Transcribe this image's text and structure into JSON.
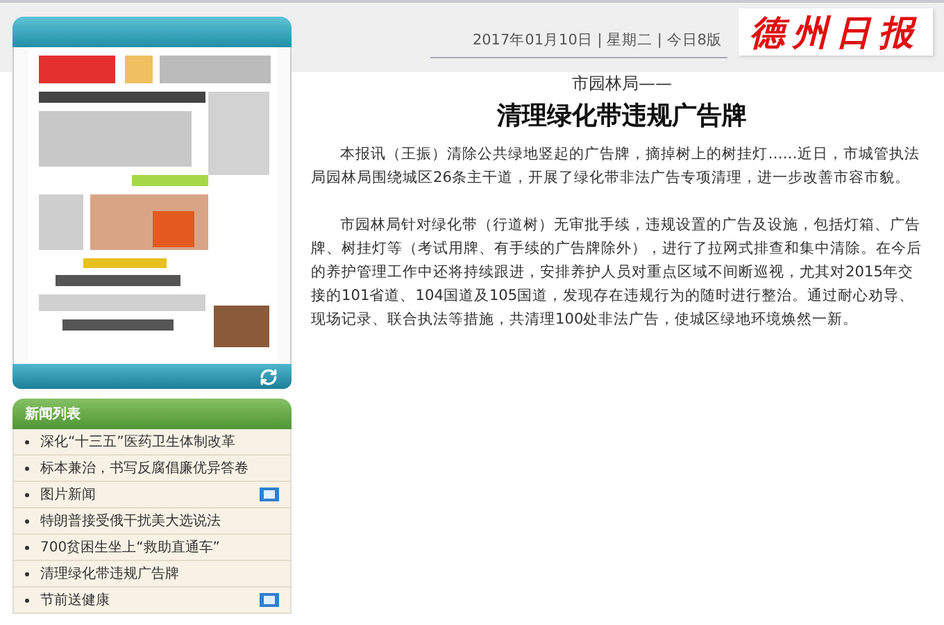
{
  "header": {
    "date_line": "2017年01月10日 | 星期二 | 今日8版",
    "logo": "德州日报"
  },
  "news_list": {
    "title": "新闻列表",
    "items": [
      {
        "text": "深化“十三五”医药卫生体制改革",
        "video": false
      },
      {
        "text": "标本兼治，书写反腐倡廉优异答卷",
        "video": false
      },
      {
        "text": "图片新闻",
        "video": true
      },
      {
        "text": "特朗普接受俄干扰美大选说法",
        "video": false
      },
      {
        "text": "700贫困生坐上“救助直通车”",
        "video": false
      },
      {
        "text": "清理绿化带违规广告牌",
        "video": false
      },
      {
        "text": "节前送健康",
        "video": true
      }
    ]
  },
  "article": {
    "kicker": "市园林局——",
    "title": "清理绿化带违规广告牌",
    "paragraphs": [
      "本报讯（王振）清除公共绿地竖起的广告牌，摘掉树上的树挂灯……近日，市城管执法局园林局围绕城区26条主干道，开展了绿化带非法广告专项清理，进一步改善市容市貌。",
      "市园林局针对绿化带（行道树）无审批手续，违规设置的广告及设施，包括灯箱、广告牌、树挂灯等（考试用牌、有手续的广告牌除外），进行了拉网式排查和集中清除。在今后的养护管理工作中还将持续跟进，安排养护人员对重点区域不间断巡视，尤其对2015年交接的101省道、104国道及105国道，发现存在违规行为的随时进行整治。通过耐心劝导、现场记录、联合执法等措施，共清理100处非法广告，使城区绿地环境焕然一新。"
    ]
  }
}
